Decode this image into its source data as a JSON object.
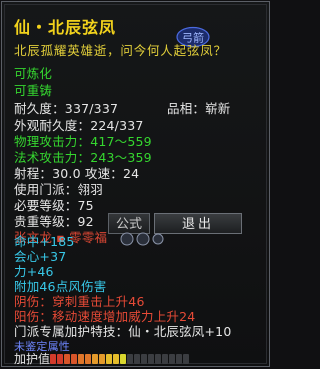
{
  "item": {
    "title": "仙・北辰弦凤",
    "bind_tag": "弓箭",
    "description": "北辰孤耀英雄逝，问今何人起弦凤？",
    "flags": [
      "可炼化",
      "可重铸"
    ],
    "durability": "耐久度：337/337",
    "grade_label": "品相：",
    "grade_value": "崭新",
    "appearance_durability": "外观耐久度：224/337",
    "phys_attack": "物理攻击力：417～559",
    "magic_attack": "法术攻击力：243～359",
    "range_speed": "射程：30.0 攻速：24",
    "faction": "使用门派：翎羽",
    "req_level": "必要等级：75",
    "noble_level": "贵重等级：92",
    "crafter": "张文龙 ▪ 零零福",
    "stats": [
      {
        "text": "命中+185",
        "color": "cyan"
      },
      {
        "text": "会心+37",
        "color": "cyan"
      },
      {
        "text": "力+46",
        "color": "cyan"
      },
      {
        "text": "附加46点风伤害",
        "color": "cyan"
      },
      {
        "text": "阴伤：穿刺重击上升46",
        "color": "red"
      },
      {
        "text": "阳伤：移动速度增加威力上升24",
        "color": "red"
      },
      {
        "text": "门派专属加护特技：仙・北辰弦凤+10",
        "color": "white"
      },
      {
        "text": "未鉴定属性",
        "color": "blue"
      }
    ],
    "protect_label": "加护值",
    "protect_level": 0.55
  },
  "buttons": {
    "formula": "公式",
    "exit": "退出"
  },
  "colors": {
    "title": "#f2d21c",
    "green": "#35d62f",
    "cyan": "#38c8e8",
    "red": "#e64a36",
    "white": "#e6e6e6",
    "blue": "#6f86ff"
  }
}
